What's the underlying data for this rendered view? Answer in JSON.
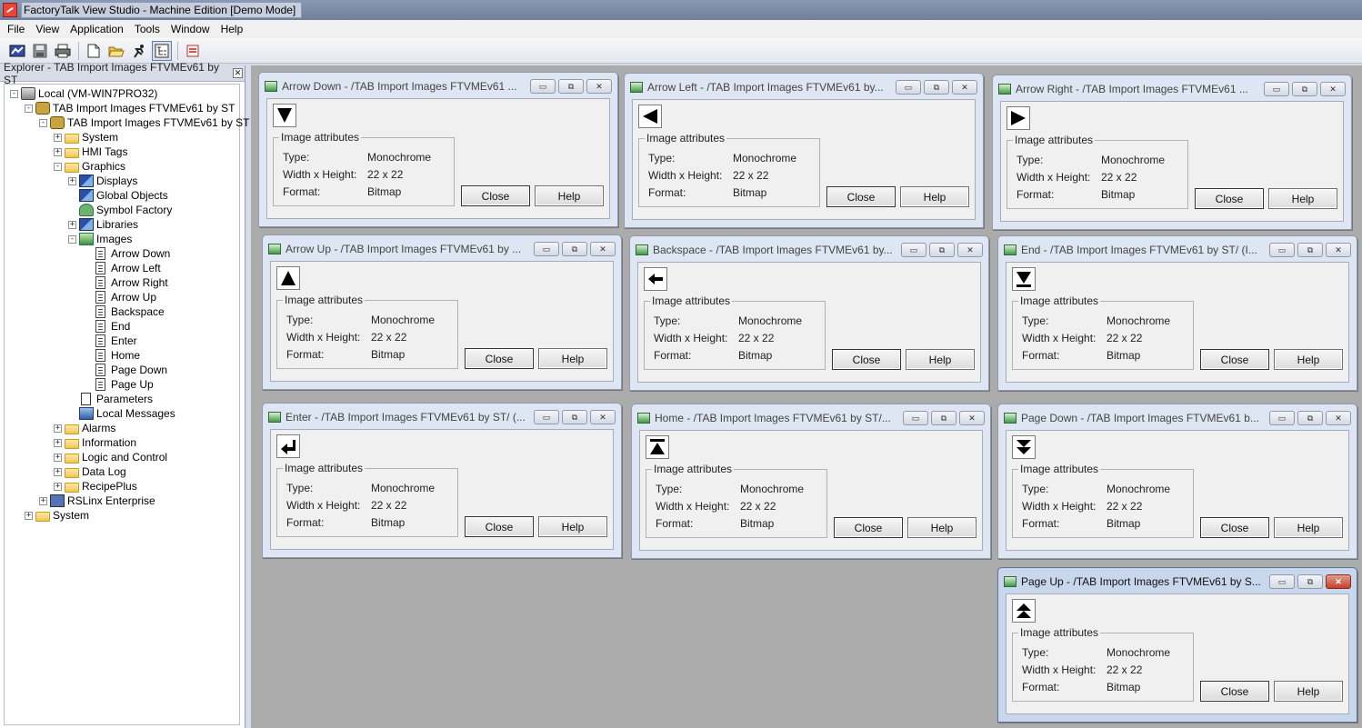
{
  "app": {
    "title": "FactoryTalk View Studio - Machine Edition  [Demo Mode]"
  },
  "menu": [
    "File",
    "View",
    "Application",
    "Tools",
    "Window",
    "Help"
  ],
  "toolbar": {
    "icons": [
      "open-project-icon",
      "save-icon",
      "print-icon",
      "new-icon",
      "open-folder-icon",
      "run-icon",
      "tree-view-icon",
      "error-list-icon"
    ]
  },
  "explorer": {
    "title": "Explorer - TAB Import Images FTVMEv61 by ST",
    "tree": [
      {
        "label": "Local (VM-WIN7PRO32)",
        "icon": "local-computer-icon",
        "expander": "-"
      },
      {
        "label": "TAB Import Images FTVMEv61 by ST",
        "icon": "application-icon",
        "expander": "-"
      },
      {
        "label": "TAB Import Images FTVMEv61 by ST",
        "icon": "hmi-server-icon",
        "expander": "-"
      },
      {
        "label": "System",
        "icon": "folder-icon",
        "expander": "+"
      },
      {
        "label": "HMI Tags",
        "icon": "folder-icon",
        "expander": "+"
      },
      {
        "label": "Graphics",
        "icon": "folder-icon",
        "expander": "-"
      },
      {
        "label": "Displays",
        "icon": "displays-icon",
        "expander": "+"
      },
      {
        "label": "Global Objects",
        "icon": "global-objects-icon",
        "expander": ""
      },
      {
        "label": "Symbol Factory",
        "icon": "symbol-factory-icon",
        "expander": ""
      },
      {
        "label": "Libraries",
        "icon": "libraries-icon",
        "expander": "+"
      },
      {
        "label": "Images",
        "icon": "images-icon",
        "expander": "-"
      },
      {
        "label": "Arrow Down",
        "icon": "image-file-icon",
        "expander": ""
      },
      {
        "label": "Arrow Left",
        "icon": "image-file-icon",
        "expander": ""
      },
      {
        "label": "Arrow Right",
        "icon": "image-file-icon",
        "expander": ""
      },
      {
        "label": "Arrow Up",
        "icon": "image-file-icon",
        "expander": ""
      },
      {
        "label": "Backspace",
        "icon": "image-file-icon",
        "expander": ""
      },
      {
        "label": "End",
        "icon": "image-file-icon",
        "expander": ""
      },
      {
        "label": "Enter",
        "icon": "image-file-icon",
        "expander": ""
      },
      {
        "label": "Home",
        "icon": "image-file-icon",
        "expander": ""
      },
      {
        "label": "Page Down",
        "icon": "image-file-icon",
        "expander": ""
      },
      {
        "label": "Page Up",
        "icon": "image-file-icon",
        "expander": ""
      },
      {
        "label": "Parameters",
        "icon": "parameters-icon",
        "expander": ""
      },
      {
        "label": "Local Messages",
        "icon": "local-messages-icon",
        "expander": ""
      },
      {
        "label": "Alarms",
        "icon": "folder-icon",
        "expander": "+"
      },
      {
        "label": "Information",
        "icon": "folder-icon",
        "expander": "+"
      },
      {
        "label": "Logic and Control",
        "icon": "folder-icon",
        "expander": "+"
      },
      {
        "label": "Data Log",
        "icon": "folder-icon",
        "expander": "+"
      },
      {
        "label": "RecipePlus",
        "icon": "folder-icon",
        "expander": "+"
      },
      {
        "label": "RSLinx Enterprise",
        "icon": "rslinx-icon",
        "expander": "+"
      },
      {
        "label": "System",
        "icon": "folder-icon",
        "expander": "+"
      }
    ]
  },
  "attr_labels": {
    "group": "Image attributes",
    "type": "Type:",
    "size": "Width x Height:",
    "format": "Format:"
  },
  "buttons": {
    "close": "Close",
    "help": "Help"
  },
  "window_buttons": {
    "minimize": "▭",
    "restore": "⧉",
    "close": "✕"
  },
  "windows": [
    {
      "title": "Arrow Down - /TAB Import Images FTVMEv61 ...",
      "glyph": "arrow-down-icon",
      "type": "Monochrome",
      "size": "22 x 22",
      "format": "Bitmap",
      "active": false
    },
    {
      "title": "Arrow Left - /TAB Import Images FTVMEv61 by...",
      "glyph": "arrow-left-icon",
      "type": "Monochrome",
      "size": "22 x 22",
      "format": "Bitmap",
      "active": false
    },
    {
      "title": "Arrow Right - /TAB Import Images FTVMEv61 ...",
      "glyph": "arrow-right-icon",
      "type": "Monochrome",
      "size": "22 x 22",
      "format": "Bitmap",
      "active": false
    },
    {
      "title": "Arrow Up - /TAB Import Images FTVMEv61 by ...",
      "glyph": "arrow-up-icon",
      "type": "Monochrome",
      "size": "22 x 22",
      "format": "Bitmap",
      "active": false
    },
    {
      "title": "Backspace - /TAB Import Images FTVMEv61 by...",
      "glyph": "backspace-icon",
      "type": "Monochrome",
      "size": "22 x 22",
      "format": "Bitmap",
      "active": false
    },
    {
      "title": "End - /TAB Import Images FTVMEv61 by ST/ (I...",
      "glyph": "end-icon",
      "type": "Monochrome",
      "size": "22 x 22",
      "format": "Bitmap",
      "active": false
    },
    {
      "title": "Enter - /TAB Import Images FTVMEv61 by ST/ (...",
      "glyph": "enter-icon",
      "type": "Monochrome",
      "size": "22 x 22",
      "format": "Bitmap",
      "active": false
    },
    {
      "title": "Home - /TAB Import Images FTVMEv61 by ST/...",
      "glyph": "home-icon",
      "type": "Monochrome",
      "size": "22 x 22",
      "format": "Bitmap",
      "active": false
    },
    {
      "title": "Page Down - /TAB Import Images FTVMEv61 b...",
      "glyph": "page-down-icon",
      "type": "Monochrome",
      "size": "22 x 22",
      "format": "Bitmap",
      "active": false
    },
    {
      "title": "Page Up - /TAB Import Images FTVMEv61 by S...",
      "glyph": "page-up-icon",
      "type": "Monochrome",
      "size": "22 x 22",
      "format": "Bitmap",
      "active": true
    }
  ],
  "colors": {
    "mdi_background": "#ababab",
    "window_frame": "#dde6f2",
    "active_close": "#c2402b"
  }
}
